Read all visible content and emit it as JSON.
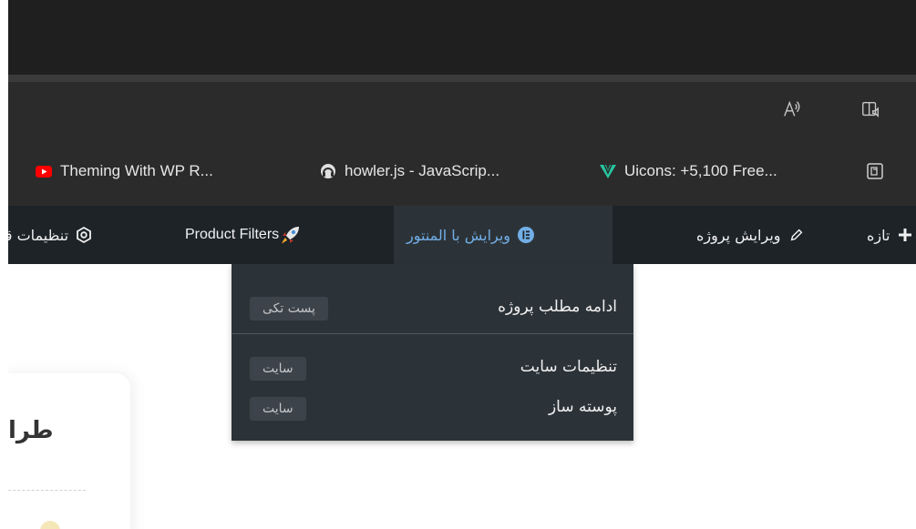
{
  "bookmarks": [
    {
      "label": "Theming With WP R...",
      "icon": "youtube-icon"
    },
    {
      "label": "howler.js - JavaScrip...",
      "icon": "headphones-icon"
    },
    {
      "label": "Uicons: +5,100 Free...",
      "icon": "uicons-logo-icon"
    },
    {
      "label": "",
      "icon": "bookmark-site-icon"
    }
  ],
  "adminbar": {
    "new_label": "تازه",
    "edit_project_label": "ویرایش پروژه",
    "elementor_label": "ویرایش با المنتور",
    "product_filters_label": "Product Filters",
    "theme_settings_label": "تنظیمات قا"
  },
  "dropdown": {
    "items": [
      {
        "label": "ادامه مطلب پروژه",
        "badge": "پست تکی"
      },
      {
        "label": "تنظیمات سایت",
        "badge": "سایت"
      },
      {
        "label": "پوسته ساز",
        "badge": "سایت"
      }
    ]
  },
  "card": {
    "title": "طرا"
  },
  "colors": {
    "adminbar_bg": "#1d2327",
    "dropdown_bg": "#2c3338",
    "active_link": "#72aee6",
    "elementor_blue": "#2271b1",
    "browser_bg": "#2b2b2b"
  }
}
